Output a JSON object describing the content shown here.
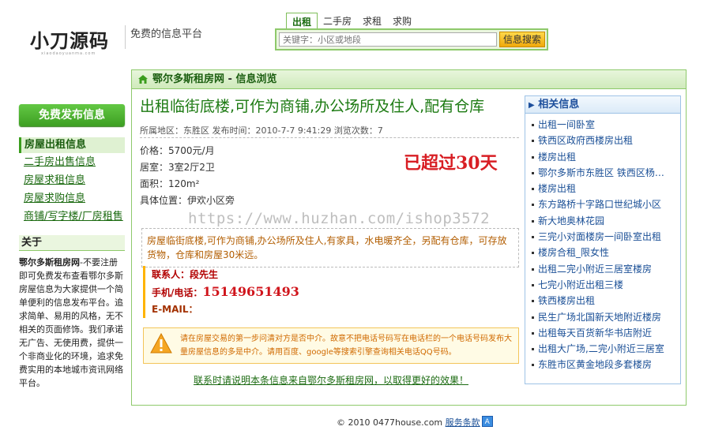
{
  "header": {
    "logo_text": "小刀源码",
    "logo_sub": "xiaodaoyuanma.com",
    "slogan": "免费的信息平台",
    "search_tabs": [
      "出租",
      "二手房",
      "求租",
      "求购"
    ],
    "search_placeholder": "关键字：小区或地段",
    "search_button": "信息搜索"
  },
  "sidebar": {
    "post_button": "免费发布信息",
    "menu_title": "房屋出租信息",
    "menu_items": [
      "二手房出售信息",
      "房屋求租信息",
      "房屋求购信息",
      "商铺/写字楼/厂房租售"
    ],
    "about_title": "关于",
    "about_name": "鄂尔多斯租房网",
    "about_body": "-不要注册即可免费发布查看鄂尔多斯房屋信息为大家提供一个简单便利的信息发布平台。追求简单、易用的风格，无不相关的页面修饰。我们承诺无广告、无使用费，提供一个非商业化的环境，追求免费实用的本地城市资讯网络平台。"
  },
  "panel": {
    "site_name": "鄂尔多斯租房网",
    "separator": " - ",
    "section": "信息浏览"
  },
  "listing": {
    "title": "出租临街底楼,可作为商铺,办公场所及住人,配有仓库",
    "meta": "所属地区：东胜区 发布时间：2010-7-7 9:41:29 浏览次数：7",
    "price": "价格：5700元/月",
    "rooms": "居室：3室2厅2卫",
    "area": "面积：120m²",
    "location": "具体位置：伊欢小区旁",
    "stamp": "已超过30天",
    "description": "房屋临街底楼,可作为商铺,办公场所及住人,有家具，水电暖齐全，另配有仓库，可存放货物，仓库和房屋30米远。",
    "contact_label": "联系人：",
    "contact_name": "段先生",
    "phone_label": "手机/电话：",
    "phone": "15149651493",
    "email_label": "E-MAIL：",
    "warning": "请在房屋交易的第一步问清对方是否中介。故意不把电话号码写在电话栏的一个电话号码发布大量房屋信息的多是中介。请用百度、google等搜索引擎查询相关电话QQ号码。",
    "footnote": "联系时请说明本条信息来自鄂尔多斯租房网，以取得更好的效果！"
  },
  "related": {
    "title": "相关信息",
    "items": [
      "出租一间卧室",
      "铁西区政府西楼房出租",
      "楼房出租",
      "鄂尔多斯市东胜区 铁西区杨家渠村",
      "楼房出租",
      "东方路桥十字路口世纪城小区",
      "新大地奥林花园",
      "三完小对面楼房一间卧室出租",
      "楼房合租_限女性",
      "出租二完小附近三居室楼房",
      "七完小附近出租三楼",
      "铁西楼房出租",
      "民生广场北国新天地附近楼房",
      "出租每天百货新华书店附近",
      "出租大广场,二完小附近三居室",
      "东胜市区黄金地段多套楼房"
    ]
  },
  "footer": {
    "copyright": "© 2010 0477house.com",
    "terms": "服务条款",
    "top_icon": "A"
  },
  "watermark": "https://www.huzhan.com/ishop3572",
  "colors": {
    "brand_green": "#3d9f22",
    "title_green": "#1c7a12",
    "stamp_red": "#d81e24",
    "link_blue": "#1a4f96"
  }
}
